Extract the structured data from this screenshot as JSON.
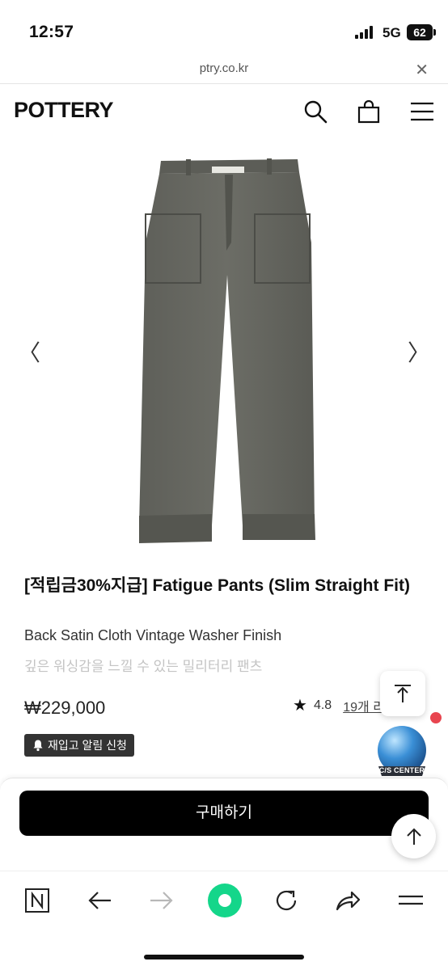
{
  "status_bar": {
    "time": "12:57",
    "network": "5G",
    "battery": "62"
  },
  "browser": {
    "url": "ptry.co.kr",
    "close_icon": "close-icon"
  },
  "header": {
    "logo": "POTTERY",
    "icons": [
      "search-icon",
      "shopping-bag-icon",
      "menu-icon"
    ]
  },
  "gallery": {
    "prev": "〈",
    "next": "〉",
    "image": "olive-grey-fatigue-pants"
  },
  "product": {
    "title": "[적립금30%지급] Fatigue Pants (Slim Straight Fit)",
    "subtitle": "Back Satin Cloth Vintage Washer Finish",
    "description": "깊은 워싱감을 느낄 수 있는 밀리터리 팬츠",
    "price": "₩229,000",
    "rating": "4.8",
    "reviews": "19개 리"
  },
  "restock": {
    "label": "재입고 알림 신청"
  },
  "cs_badge": {
    "label": "C/S CENTER"
  },
  "buy": {
    "label": "구매하기"
  },
  "toolbar": {
    "items": [
      "n-home-icon",
      "back-arrow-icon",
      "forward-arrow-icon",
      "green-dot-icon",
      "refresh-icon",
      "share-icon",
      "menu-lines-icon"
    ]
  },
  "colors": {
    "accent_green": "#14d68a",
    "cs_blue": "#3a8fd6",
    "alert_red": "#e8454f"
  }
}
